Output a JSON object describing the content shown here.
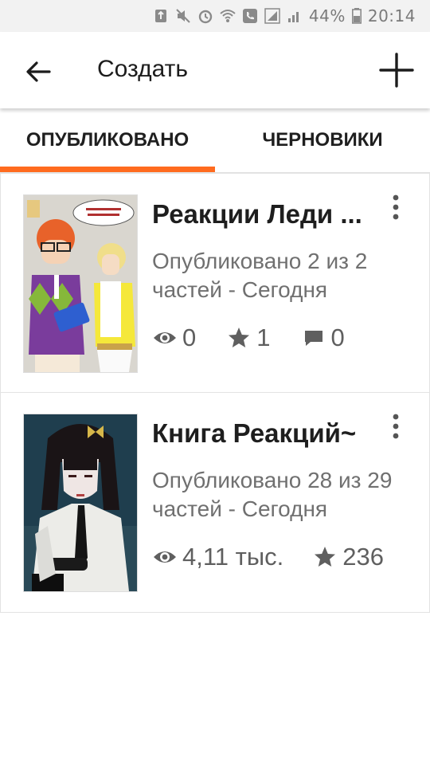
{
  "status_bar": {
    "battery": "44%",
    "time": "20:14"
  },
  "app_bar": {
    "title": "Создать"
  },
  "tabs": [
    {
      "label": "ОПУБЛИКОВАНО",
      "active": true
    },
    {
      "label": "ЧЕРНОВИКИ",
      "active": false
    }
  ],
  "stories": [
    {
      "title": "Реакции Леди ...",
      "published": "Опубликовано 2 из 2 частей - Сегодня",
      "views": "0",
      "stars": "1",
      "comments": "0"
    },
    {
      "title": "Книга Реакций~",
      "published": "Опубликовано 28 из 29 частей - Сегодня",
      "views": "4,11 тыс.",
      "stars": "236"
    }
  ],
  "colors": {
    "accent": "#ff6b1f",
    "text": "#1e1e1e",
    "secondary_text": "#707070",
    "status_bar_bg": "#f2f2f2"
  },
  "icons": {
    "back": "arrow-left-icon",
    "add": "plus-icon",
    "more": "more-vertical-icon",
    "views": "eye-icon",
    "stars": "star-icon",
    "comments": "comment-icon"
  }
}
